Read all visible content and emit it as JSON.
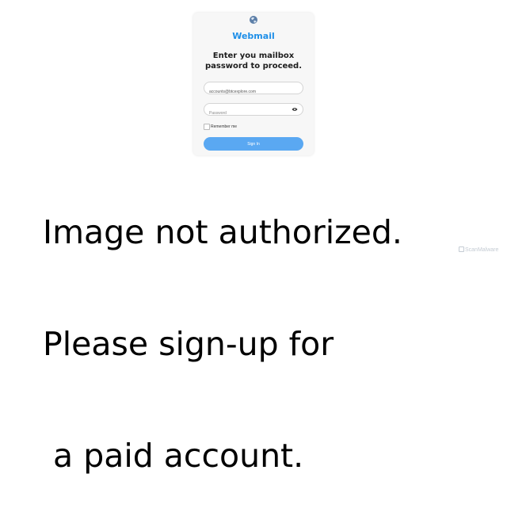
{
  "login": {
    "globe_icon": "globe-icon",
    "brand": "Webmail",
    "heading_line1": "Enter you mailbox",
    "heading_line2": "password to proceed.",
    "email": {
      "value": "accounts@btcexplore.com"
    },
    "password": {
      "value": "",
      "placeholder": "Password",
      "toggle_icon": "eye-icon"
    },
    "remember_label": "Remember me",
    "remember_checked": false,
    "signin_label": "Sign In"
  },
  "overlay": {
    "line1": "Image not authorized.",
    "line2": "Please sign-up for",
    "line3": " a paid account."
  },
  "watermark": {
    "text": "ScanMalware"
  },
  "colors": {
    "brand": "#1e8fe8",
    "button": "#5aa8f2",
    "card": "#f7f7f7"
  }
}
